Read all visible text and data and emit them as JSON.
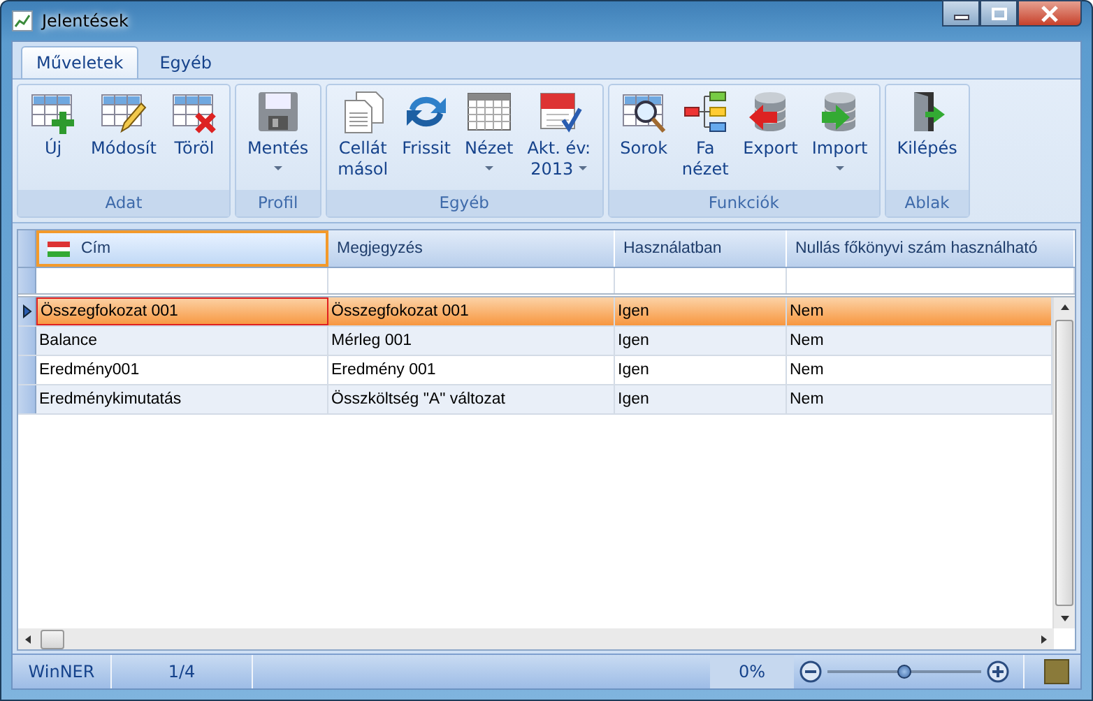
{
  "window": {
    "title": "Jelentések"
  },
  "tabs": [
    {
      "label": "Műveletek",
      "selected": true
    },
    {
      "label": "Egyéb",
      "selected": false
    }
  ],
  "ribbon_groups": [
    {
      "label": "Adat",
      "buttons": [
        {
          "lines": [
            "Új"
          ],
          "dropdown": false
        },
        {
          "lines": [
            "Módosít"
          ],
          "dropdown": false
        },
        {
          "lines": [
            "Töröl"
          ],
          "dropdown": false
        }
      ]
    },
    {
      "label": "Profil",
      "buttons": [
        {
          "lines": [
            "Mentés"
          ],
          "dropdown": true
        }
      ]
    },
    {
      "label": "Egyéb",
      "buttons": [
        {
          "lines": [
            "Cellát",
            "másol"
          ],
          "dropdown": false
        },
        {
          "lines": [
            "Frissit"
          ],
          "dropdown": false
        },
        {
          "lines": [
            "Nézet"
          ],
          "dropdown": true
        },
        {
          "lines": [
            "Akt. év:",
            "2013"
          ],
          "dropdown": true
        }
      ]
    },
    {
      "label": "Funkciók",
      "buttons": [
        {
          "lines": [
            "Sorok"
          ],
          "dropdown": false
        },
        {
          "lines": [
            "Fa",
            "nézet"
          ],
          "dropdown": false
        },
        {
          "lines": [
            "Export"
          ],
          "dropdown": false
        },
        {
          "lines": [
            "Import"
          ],
          "dropdown": true
        }
      ]
    },
    {
      "label": "Ablak",
      "buttons": [
        {
          "lines": [
            "Kilépés"
          ],
          "dropdown": false
        }
      ]
    }
  ],
  "table": {
    "columns": [
      {
        "label": "Cím",
        "selected": true
      },
      {
        "label": "Megjegyzés",
        "selected": false
      },
      {
        "label": "Használatban",
        "selected": false
      },
      {
        "label": "Nullás főkönyvi szám használható",
        "selected": false
      }
    ],
    "rows": [
      {
        "selected": true,
        "cells": [
          "Összegfokozat 001",
          "Összegfokozat 001",
          "Igen",
          "Nem"
        ]
      },
      {
        "selected": false,
        "cells": [
          "Balance",
          "Mérleg 001",
          "Igen",
          "Nem"
        ]
      },
      {
        "selected": false,
        "cells": [
          "Eredmény001",
          "Eredmény 001",
          "Igen",
          "Nem"
        ]
      },
      {
        "selected": false,
        "cells": [
          "Eredménykimutatás",
          "Összköltség \"A\" változat",
          "Igen",
          "Nem"
        ]
      }
    ]
  },
  "status_bar": {
    "app": "WinNER",
    "record": "1/4",
    "zoom_text": "0%",
    "zoom": {
      "level": 0.5
    }
  }
}
